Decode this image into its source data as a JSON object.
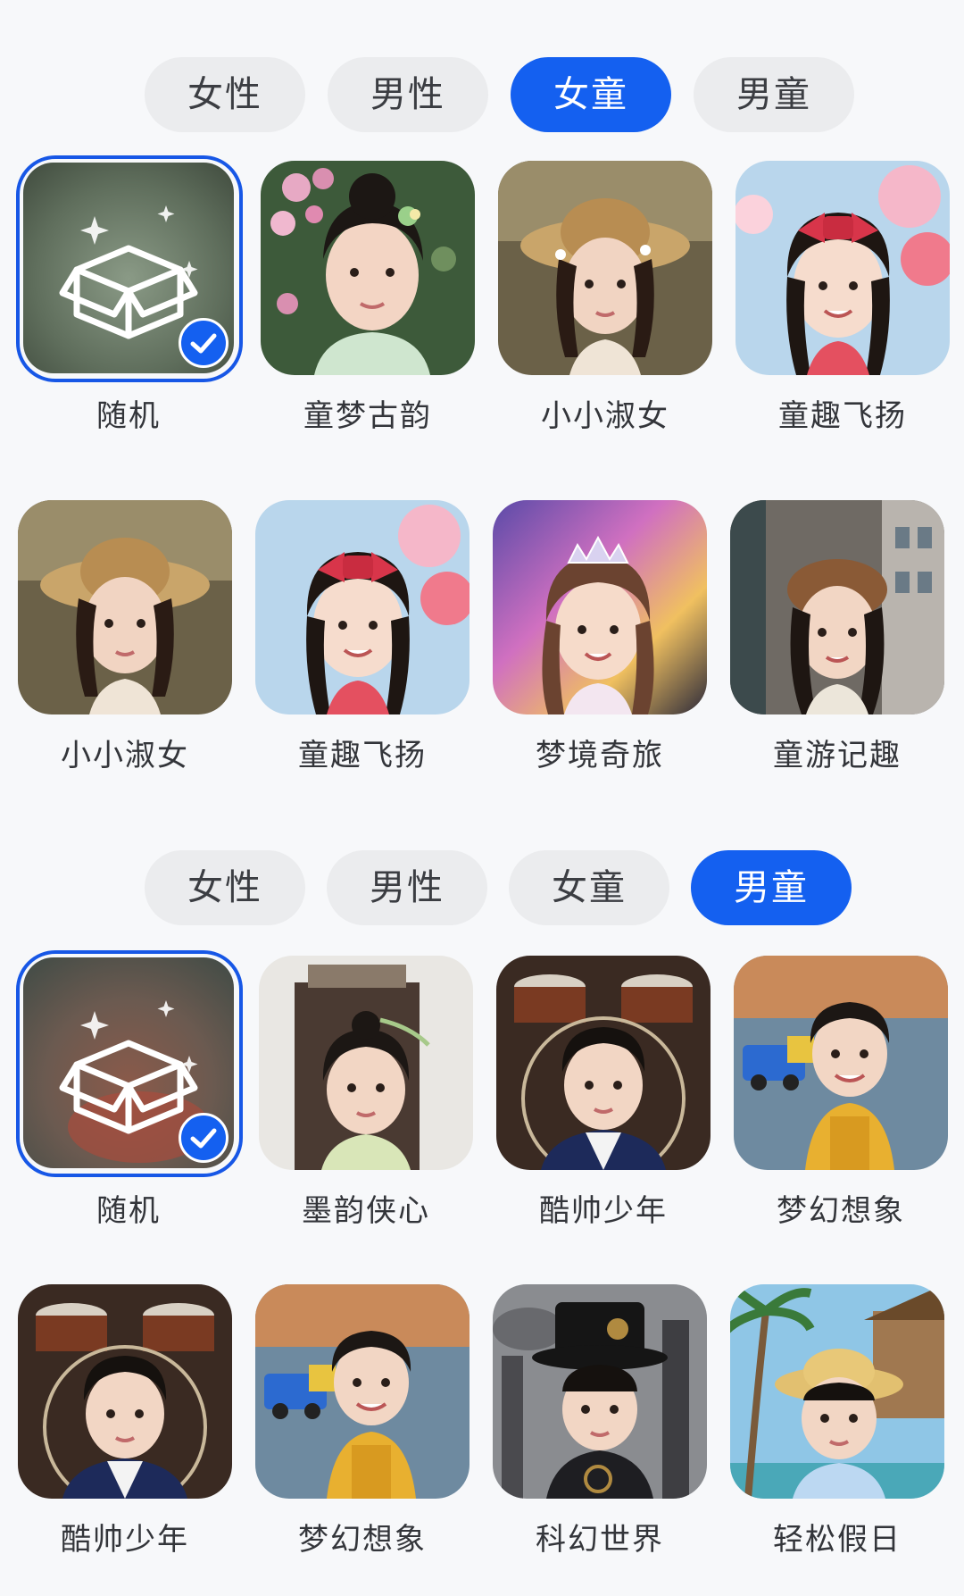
{
  "sections": [
    {
      "tabs": [
        {
          "label": "女性",
          "active": false
        },
        {
          "label": "男性",
          "active": false
        },
        {
          "label": "女童",
          "active": true
        },
        {
          "label": "男童",
          "active": false
        }
      ],
      "styles": [
        {
          "label": "随机",
          "selected": true,
          "icon": "box-icon"
        },
        {
          "label": "童梦古韵",
          "selected": false
        },
        {
          "label": "小小淑女",
          "selected": false
        },
        {
          "label": "童趣飞扬",
          "selected": false
        },
        {
          "label": "小小淑女",
          "selected": false
        },
        {
          "label": "童趣飞扬",
          "selected": false
        },
        {
          "label": "梦境奇旅",
          "selected": false
        },
        {
          "label": "童游记趣",
          "selected": false
        }
      ]
    },
    {
      "tabs": [
        {
          "label": "女性",
          "active": false
        },
        {
          "label": "男性",
          "active": false
        },
        {
          "label": "女童",
          "active": false
        },
        {
          "label": "男童",
          "active": true
        }
      ],
      "styles": [
        {
          "label": "随机",
          "selected": true,
          "icon": "box-icon"
        },
        {
          "label": "墨韵侠心",
          "selected": false
        },
        {
          "label": "酷帅少年",
          "selected": false
        },
        {
          "label": "梦幻想象",
          "selected": false
        },
        {
          "label": "酷帅少年",
          "selected": false
        },
        {
          "label": "梦幻想象",
          "selected": false
        },
        {
          "label": "科幻世界",
          "selected": false
        },
        {
          "label": "轻松假日",
          "selected": false
        }
      ]
    }
  ],
  "colors": {
    "accent": "#1460f0",
    "tab_inactive_bg": "#ebecee",
    "page_bg": "#f7f8fa"
  }
}
